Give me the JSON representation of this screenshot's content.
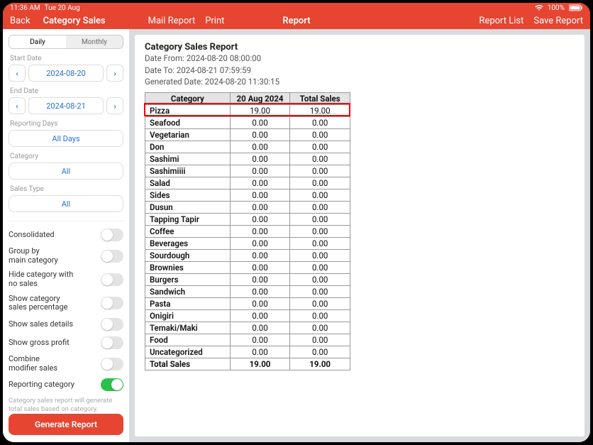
{
  "statusbar": {
    "time": "11:36 AM",
    "date": "Tue 20 Aug",
    "battery": "100%"
  },
  "nav1": {
    "back": "Back",
    "title": "Category Sales"
  },
  "nav2": {
    "mail": "Mail Report",
    "print": "Print",
    "center": "Report",
    "list": "Report List",
    "save": "Save Report"
  },
  "sidebar": {
    "seg": {
      "daily": "Daily",
      "monthly": "Monthly"
    },
    "start_label": "Start Date",
    "start_date": "2024-08-20",
    "end_label": "End Date",
    "end_date": "2024-08-21",
    "reporting_days_label": "Reporting Days",
    "reporting_days_value": "All Days",
    "category_label": "Category",
    "category_value": "All",
    "salestype_label": "Sales Type",
    "salestype_value": "All",
    "toggles": {
      "consolidated": "Consolidated",
      "group_main": "Group by\nmain category",
      "hide_nosales": "Hide category with\nno sales",
      "show_pct": "Show category\nsales percentage",
      "show_details": "Show sales details",
      "gross_profit": "Show gross profit",
      "combine_mod": "Combine\nmodifier sales",
      "reporting_cat": "Reporting category"
    },
    "help": "Category sales report will generate total sales based on category.",
    "generate": "Generate Report"
  },
  "report": {
    "title": "Category Sales Report",
    "from": "Date From: 2024-08-20 08:00:00",
    "to": "Date To: 2024-08-21 07:59:59",
    "generated": "Generated Date: 2024-08-20 11:30:15",
    "headers": {
      "cat": "Category",
      "date": "20 Aug 2024",
      "total": "Total Sales"
    },
    "rows": [
      {
        "cat": "Pizza",
        "v": "19.00",
        "t": "19.00",
        "highlight": true
      },
      {
        "cat": "Seafood",
        "v": "0.00",
        "t": "0.00"
      },
      {
        "cat": "Vegetarian",
        "v": "0.00",
        "t": "0.00"
      },
      {
        "cat": "Don",
        "v": "0.00",
        "t": "0.00"
      },
      {
        "cat": "Sashimi",
        "v": "0.00",
        "t": "0.00"
      },
      {
        "cat": "Sashimiiii",
        "v": "0.00",
        "t": "0.00"
      },
      {
        "cat": "Salad",
        "v": "0.00",
        "t": "0.00"
      },
      {
        "cat": "Sides",
        "v": "0.00",
        "t": "0.00"
      },
      {
        "cat": "Dusun",
        "v": "0.00",
        "t": "0.00"
      },
      {
        "cat": "Tapping Tapir",
        "v": "0.00",
        "t": "0.00"
      },
      {
        "cat": "Coffee",
        "v": "0.00",
        "t": "0.00"
      },
      {
        "cat": "Beverages",
        "v": "0.00",
        "t": "0.00"
      },
      {
        "cat": "Sourdough",
        "v": "0.00",
        "t": "0.00"
      },
      {
        "cat": "Brownies",
        "v": "0.00",
        "t": "0.00"
      },
      {
        "cat": "Burgers",
        "v": "0.00",
        "t": "0.00"
      },
      {
        "cat": "Sandwich",
        "v": "0.00",
        "t": "0.00"
      },
      {
        "cat": "Pasta",
        "v": "0.00",
        "t": "0.00"
      },
      {
        "cat": "Onigiri",
        "v": "0.00",
        "t": "0.00"
      },
      {
        "cat": "Temaki/Maki",
        "v": "0.00",
        "t": "0.00"
      },
      {
        "cat": "Food",
        "v": "0.00",
        "t": "0.00"
      },
      {
        "cat": "Uncategorized",
        "v": "0.00",
        "t": "0.00"
      }
    ],
    "total_row": {
      "cat": "Total Sales",
      "v": "19.00",
      "t": "19.00"
    }
  }
}
